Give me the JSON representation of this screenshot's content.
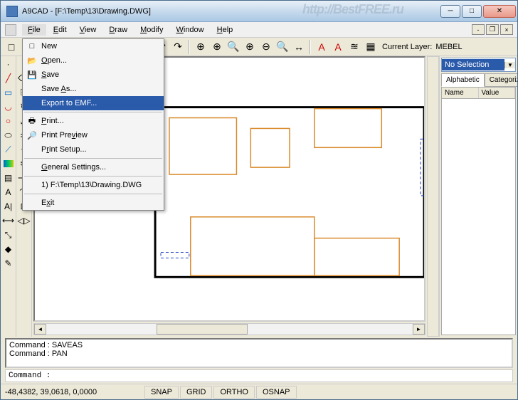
{
  "title": "A9CAD - [F:\\Temp\\13\\Drawing.DWG]",
  "watermark": "http://BestFREE.ru",
  "menubar": [
    "File",
    "Edit",
    "View",
    "Draw",
    "Modify",
    "Window",
    "Help"
  ],
  "file_menu": {
    "items": [
      {
        "label": "New",
        "icon": "new-icon"
      },
      {
        "label": "Open...",
        "icon": "open-icon"
      },
      {
        "label": "Save",
        "icon": "save-icon"
      },
      {
        "label": "Save As..."
      },
      {
        "label": "Export to EMF...",
        "highlight": true
      },
      {
        "label": "Print...",
        "icon": "print-icon"
      },
      {
        "label": "Print Preview",
        "icon": "preview-icon"
      },
      {
        "label": "Print Setup..."
      },
      {
        "label": "General Settings..."
      },
      {
        "label": "1) F:\\Temp\\13\\Drawing.DWG"
      },
      {
        "label": "Exit"
      }
    ]
  },
  "layer": {
    "label": "Current Layer:",
    "value": "MEBEL"
  },
  "properties": {
    "selection": "No Selection",
    "tabs": [
      "Alphabetic",
      "Categorized"
    ],
    "cols": [
      "Name",
      "Value"
    ]
  },
  "command_history": [
    "Command : SAVEAS",
    "Command : PAN"
  ],
  "command_prompt": "Command :",
  "status": {
    "coords": "-48,4382, 39,0618, 0,0000",
    "toggles": [
      "SNAP",
      "GRID",
      "ORTHO",
      "OSNAP"
    ]
  }
}
